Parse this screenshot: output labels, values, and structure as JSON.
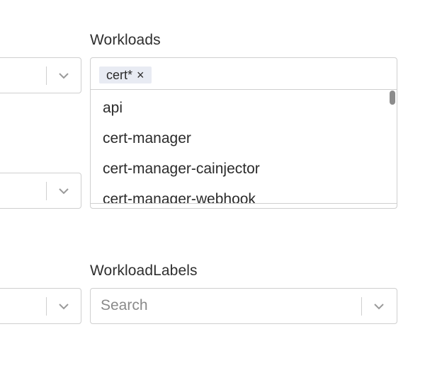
{
  "workloads": {
    "label": "Workloads",
    "selected_tag": "cert*",
    "tag_remove_glyph": "×",
    "options": [
      "api",
      "cert-manager",
      "cert-manager-cainjector",
      "cert-manager-webhook"
    ]
  },
  "workload_labels": {
    "label": "WorkloadLabels",
    "placeholder": "Search"
  },
  "icons": {
    "chevron": "chevron-down-icon"
  },
  "colors": {
    "border": "#cfcfcf",
    "tag_bg": "#e8ebf3",
    "scrollbar": "#8c8c8c"
  }
}
